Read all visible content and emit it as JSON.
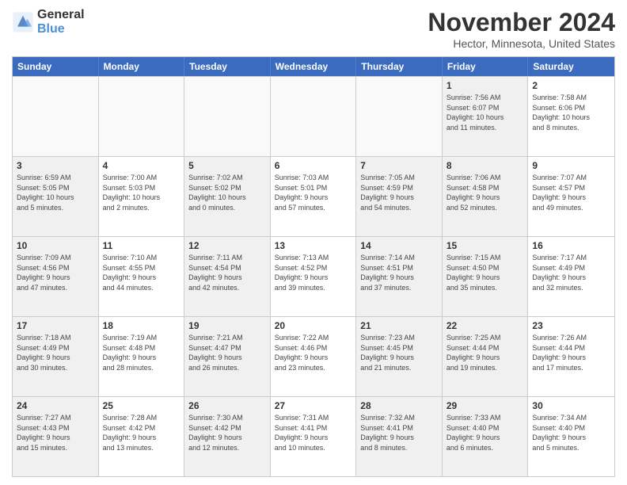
{
  "header": {
    "logo_line1": "General",
    "logo_line2": "Blue",
    "month": "November 2024",
    "location": "Hector, Minnesota, United States"
  },
  "weekdays": [
    "Sunday",
    "Monday",
    "Tuesday",
    "Wednesday",
    "Thursday",
    "Friday",
    "Saturday"
  ],
  "rows": [
    [
      {
        "day": "",
        "info": "",
        "empty": true
      },
      {
        "day": "",
        "info": "",
        "empty": true
      },
      {
        "day": "",
        "info": "",
        "empty": true
      },
      {
        "day": "",
        "info": "",
        "empty": true
      },
      {
        "day": "",
        "info": "",
        "empty": true
      },
      {
        "day": "1",
        "info": "Sunrise: 7:56 AM\nSunset: 6:07 PM\nDaylight: 10 hours\nand 11 minutes.",
        "shade": true
      },
      {
        "day": "2",
        "info": "Sunrise: 7:58 AM\nSunset: 6:06 PM\nDaylight: 10 hours\nand 8 minutes."
      }
    ],
    [
      {
        "day": "3",
        "info": "Sunrise: 6:59 AM\nSunset: 5:05 PM\nDaylight: 10 hours\nand 5 minutes.",
        "shade": true
      },
      {
        "day": "4",
        "info": "Sunrise: 7:00 AM\nSunset: 5:03 PM\nDaylight: 10 hours\nand 2 minutes."
      },
      {
        "day": "5",
        "info": "Sunrise: 7:02 AM\nSunset: 5:02 PM\nDaylight: 10 hours\nand 0 minutes.",
        "shade": true
      },
      {
        "day": "6",
        "info": "Sunrise: 7:03 AM\nSunset: 5:01 PM\nDaylight: 9 hours\nand 57 minutes."
      },
      {
        "day": "7",
        "info": "Sunrise: 7:05 AM\nSunset: 4:59 PM\nDaylight: 9 hours\nand 54 minutes.",
        "shade": true
      },
      {
        "day": "8",
        "info": "Sunrise: 7:06 AM\nSunset: 4:58 PM\nDaylight: 9 hours\nand 52 minutes.",
        "shade": true
      },
      {
        "day": "9",
        "info": "Sunrise: 7:07 AM\nSunset: 4:57 PM\nDaylight: 9 hours\nand 49 minutes."
      }
    ],
    [
      {
        "day": "10",
        "info": "Sunrise: 7:09 AM\nSunset: 4:56 PM\nDaylight: 9 hours\nand 47 minutes.",
        "shade": true
      },
      {
        "day": "11",
        "info": "Sunrise: 7:10 AM\nSunset: 4:55 PM\nDaylight: 9 hours\nand 44 minutes."
      },
      {
        "day": "12",
        "info": "Sunrise: 7:11 AM\nSunset: 4:54 PM\nDaylight: 9 hours\nand 42 minutes.",
        "shade": true
      },
      {
        "day": "13",
        "info": "Sunrise: 7:13 AM\nSunset: 4:52 PM\nDaylight: 9 hours\nand 39 minutes."
      },
      {
        "day": "14",
        "info": "Sunrise: 7:14 AM\nSunset: 4:51 PM\nDaylight: 9 hours\nand 37 minutes.",
        "shade": true
      },
      {
        "day": "15",
        "info": "Sunrise: 7:15 AM\nSunset: 4:50 PM\nDaylight: 9 hours\nand 35 minutes.",
        "shade": true
      },
      {
        "day": "16",
        "info": "Sunrise: 7:17 AM\nSunset: 4:49 PM\nDaylight: 9 hours\nand 32 minutes."
      }
    ],
    [
      {
        "day": "17",
        "info": "Sunrise: 7:18 AM\nSunset: 4:49 PM\nDaylight: 9 hours\nand 30 minutes.",
        "shade": true
      },
      {
        "day": "18",
        "info": "Sunrise: 7:19 AM\nSunset: 4:48 PM\nDaylight: 9 hours\nand 28 minutes."
      },
      {
        "day": "19",
        "info": "Sunrise: 7:21 AM\nSunset: 4:47 PM\nDaylight: 9 hours\nand 26 minutes.",
        "shade": true
      },
      {
        "day": "20",
        "info": "Sunrise: 7:22 AM\nSunset: 4:46 PM\nDaylight: 9 hours\nand 23 minutes."
      },
      {
        "day": "21",
        "info": "Sunrise: 7:23 AM\nSunset: 4:45 PM\nDaylight: 9 hours\nand 21 minutes.",
        "shade": true
      },
      {
        "day": "22",
        "info": "Sunrise: 7:25 AM\nSunset: 4:44 PM\nDaylight: 9 hours\nand 19 minutes.",
        "shade": true
      },
      {
        "day": "23",
        "info": "Sunrise: 7:26 AM\nSunset: 4:44 PM\nDaylight: 9 hours\nand 17 minutes."
      }
    ],
    [
      {
        "day": "24",
        "info": "Sunrise: 7:27 AM\nSunset: 4:43 PM\nDaylight: 9 hours\nand 15 minutes.",
        "shade": true
      },
      {
        "day": "25",
        "info": "Sunrise: 7:28 AM\nSunset: 4:42 PM\nDaylight: 9 hours\nand 13 minutes."
      },
      {
        "day": "26",
        "info": "Sunrise: 7:30 AM\nSunset: 4:42 PM\nDaylight: 9 hours\nand 12 minutes.",
        "shade": true
      },
      {
        "day": "27",
        "info": "Sunrise: 7:31 AM\nSunset: 4:41 PM\nDaylight: 9 hours\nand 10 minutes."
      },
      {
        "day": "28",
        "info": "Sunrise: 7:32 AM\nSunset: 4:41 PM\nDaylight: 9 hours\nand 8 minutes.",
        "shade": true
      },
      {
        "day": "29",
        "info": "Sunrise: 7:33 AM\nSunset: 4:40 PM\nDaylight: 9 hours\nand 6 minutes.",
        "shade": true
      },
      {
        "day": "30",
        "info": "Sunrise: 7:34 AM\nSunset: 4:40 PM\nDaylight: 9 hours\nand 5 minutes."
      }
    ]
  ]
}
